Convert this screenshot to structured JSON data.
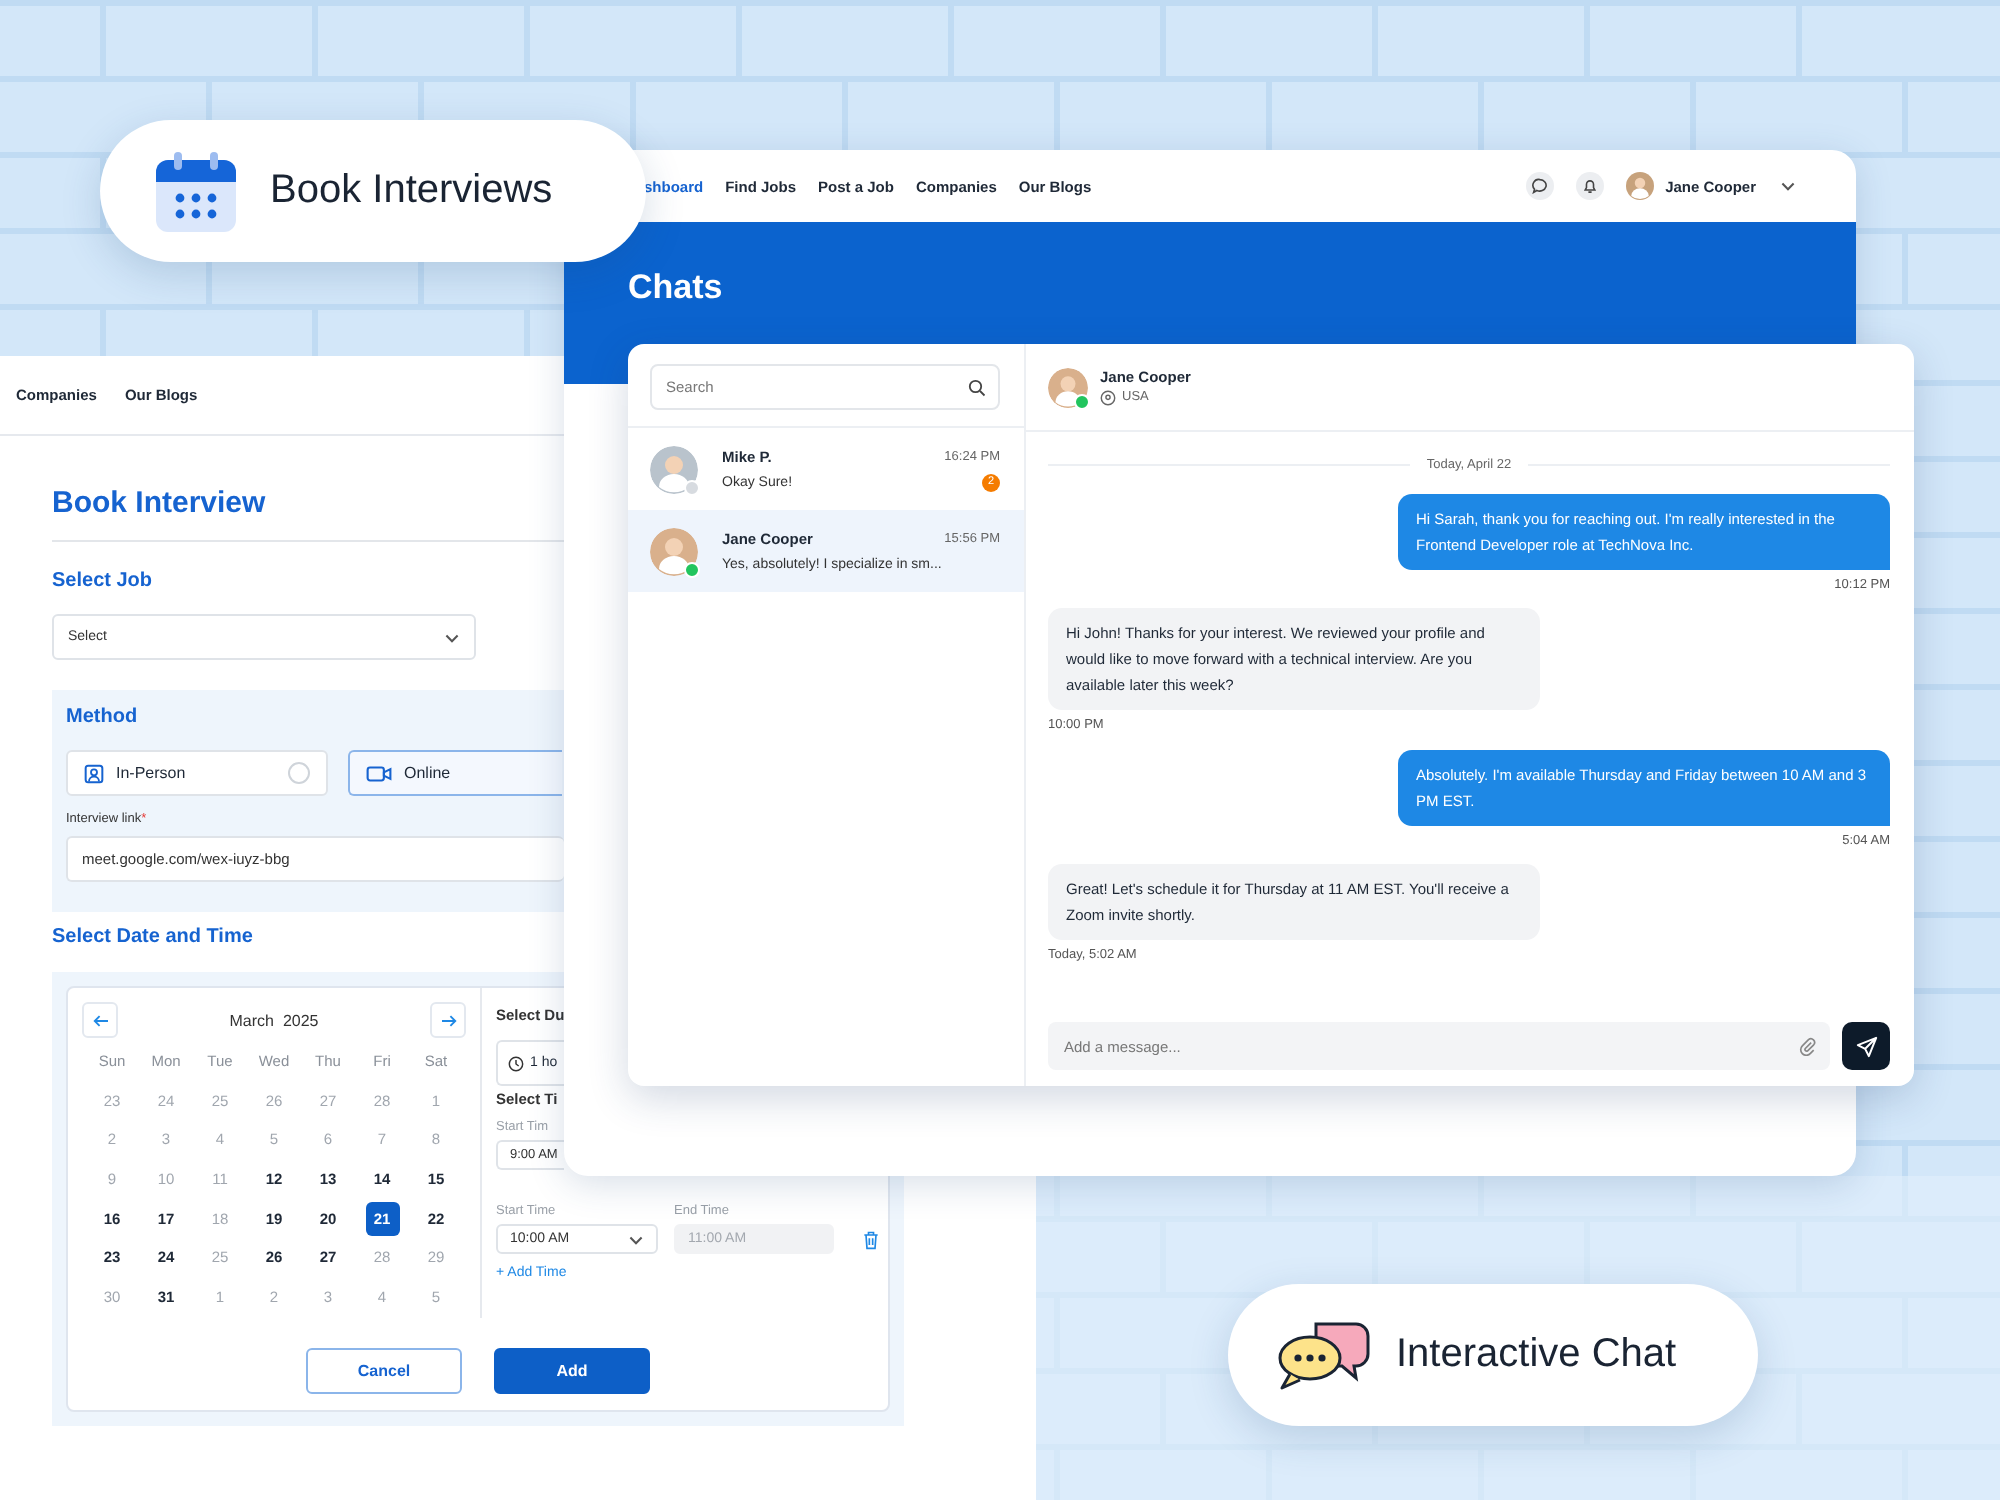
{
  "promo_labels": [
    {
      "kind": "calendar",
      "text": "Book Interviews"
    },
    {
      "kind": "chat",
      "text": "Interactive Chat"
    }
  ],
  "booking_page": {
    "nav": [
      {
        "label": "Companies",
        "selected": false
      },
      {
        "label": "Our Blogs",
        "selected": false
      }
    ],
    "title": "Book Interview",
    "job": {
      "heading": "Select Job",
      "placeholder": "Select"
    },
    "method": {
      "heading": "Method",
      "options": [
        {
          "kind": "in_person",
          "label": "In-Person",
          "selected": false
        },
        {
          "kind": "online",
          "label": "Online",
          "selected": true
        }
      ],
      "link_label": "Interview link",
      "required_mark": "*",
      "link_value": "meet.google.com/wex-iuyz-bbg"
    },
    "date_heading": "Select Date and Time",
    "calendar": {
      "month": "March  2025",
      "weekdays": [
        "Sun",
        "Mon",
        "Tue",
        "Wed",
        "Thu",
        "Fri",
        "Sat"
      ],
      "days": [
        {
          "label": "23",
          "muted": true,
          "selected": false
        },
        {
          "label": "24",
          "muted": true,
          "selected": false
        },
        {
          "label": "25",
          "muted": true,
          "selected": false
        },
        {
          "label": "26",
          "muted": true,
          "selected": false
        },
        {
          "label": "27",
          "muted": true,
          "selected": false
        },
        {
          "label": "28",
          "muted": true,
          "selected": false
        },
        {
          "label": "1",
          "muted": true,
          "selected": false
        },
        {
          "label": "2",
          "muted": true,
          "selected": false
        },
        {
          "label": "3",
          "muted": true,
          "selected": false
        },
        {
          "label": "4",
          "muted": true,
          "selected": false
        },
        {
          "label": "5",
          "muted": true,
          "selected": false
        },
        {
          "label": "6",
          "muted": true,
          "selected": false
        },
        {
          "label": "7",
          "muted": true,
          "selected": false
        },
        {
          "label": "8",
          "muted": true,
          "selected": false
        },
        {
          "label": "9",
          "muted": true,
          "selected": false
        },
        {
          "label": "10",
          "muted": true,
          "selected": false
        },
        {
          "label": "11",
          "muted": true,
          "selected": false
        },
        {
          "label": "12",
          "muted": false,
          "selected": false
        },
        {
          "label": "13",
          "muted": false,
          "selected": false
        },
        {
          "label": "14",
          "muted": false,
          "selected": false
        },
        {
          "label": "15",
          "muted": false,
          "selected": false
        },
        {
          "label": "16",
          "muted": false,
          "selected": false
        },
        {
          "label": "17",
          "muted": false,
          "selected": false
        },
        {
          "label": "18",
          "muted": true,
          "selected": false
        },
        {
          "label": "19",
          "muted": false,
          "selected": false
        },
        {
          "label": "20",
          "muted": false,
          "selected": false
        },
        {
          "label": "21",
          "muted": false,
          "selected": true
        },
        {
          "label": "22",
          "muted": false,
          "selected": false
        },
        {
          "label": "23",
          "muted": false,
          "selected": false
        },
        {
          "label": "24",
          "muted": false,
          "selected": false
        },
        {
          "label": "25",
          "muted": true,
          "selected": false
        },
        {
          "label": "26",
          "muted": false,
          "selected": false
        },
        {
          "label": "27",
          "muted": false,
          "selected": false
        },
        {
          "label": "28",
          "muted": true,
          "selected": false
        },
        {
          "label": "29",
          "muted": true,
          "selected": false
        },
        {
          "label": "30",
          "muted": true,
          "selected": false
        },
        {
          "label": "31",
          "muted": false,
          "selected": false
        },
        {
          "label": "1",
          "muted": true,
          "selected": false
        },
        {
          "label": "2",
          "muted": true,
          "selected": false
        },
        {
          "label": "3",
          "muted": true,
          "selected": false
        },
        {
          "label": "4",
          "muted": true,
          "selected": false
        },
        {
          "label": "5",
          "muted": true,
          "selected": false
        }
      ]
    },
    "duration": {
      "heading": "Select Du",
      "value": "1 ho"
    },
    "time_heading": "Select Ti",
    "time_rows": [
      {
        "kind": "start_only",
        "start_label": "Start Tim",
        "start_value": "9:00 AM"
      },
      {
        "kind": "range",
        "start_label": "Start Time",
        "start_value": "10:00 AM",
        "end_label": "End Time",
        "end_value": "11:00 AM",
        "end_disabled": true
      }
    ],
    "add_time": "+ Add Time",
    "buttons": [
      {
        "kind": "secondary",
        "label": "Cancel"
      },
      {
        "kind": "primary",
        "label": "Add"
      }
    ]
  },
  "chat_page": {
    "nav": [
      {
        "label": "shboard",
        "selected": true
      },
      {
        "label": "Find Jobs",
        "selected": false
      },
      {
        "label": "Post a Job",
        "selected": false
      },
      {
        "label": "Companies",
        "selected": false
      },
      {
        "label": "Our Blogs",
        "selected": false
      }
    ],
    "user": {
      "name": "Jane Cooper"
    },
    "title": "Chats",
    "search": {
      "placeholder": "Search"
    },
    "conversations": [
      {
        "name": "Mike P.",
        "time": "16:24 PM",
        "preview": "Okay Sure!",
        "unread": "2",
        "online": false,
        "selected": false
      },
      {
        "name": "Jane Cooper",
        "time": "15:56 PM",
        "preview": "Yes, absolutely! I specialize in sm...",
        "online": true,
        "selected": true
      }
    ],
    "contact": {
      "name": "Jane Cooper",
      "location": "USA",
      "online": true
    },
    "date_divider": "Today, April 22",
    "messages": [
      {
        "kind": "sent",
        "text": "Hi Sarah, thank you for reaching out. I'm really interested in the Frontend Developer role at TechNova Inc.",
        "time": "10:12 PM"
      },
      {
        "kind": "received",
        "text": "Hi John! Thanks for your interest. We reviewed your profile and would like to move forward with a technical interview. Are you available later this week?",
        "time": "10:00 PM"
      },
      {
        "kind": "sent",
        "text": "Absolutely. I'm available Thursday and Friday between 10 AM and 3 PM EST.",
        "time": "5:04 AM"
      },
      {
        "kind": "received",
        "text": "Great! Let's schedule it for Thursday at 11 AM EST. You'll receive a Zoom invite shortly.",
        "time": "Today, 5:02 AM"
      }
    ],
    "composer": {
      "placeholder": "Add a message..."
    }
  }
}
